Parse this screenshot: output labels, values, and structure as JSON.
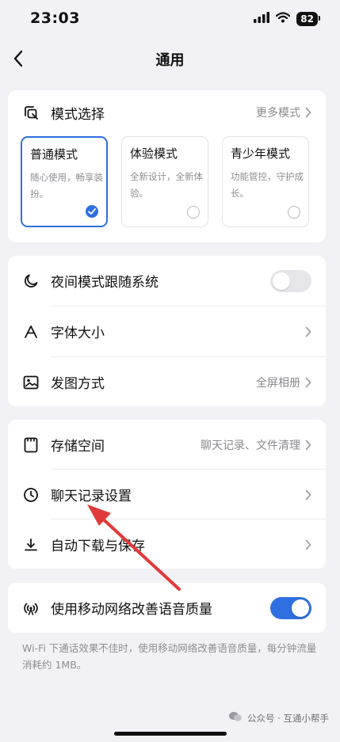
{
  "status_bar": {
    "time": "23:03",
    "battery": "82"
  },
  "nav": {
    "title": "通用"
  },
  "mode_section": {
    "label": "模式选择",
    "more": "更多模式",
    "modes": [
      {
        "title": "普通模式",
        "desc": "随心使用，畅享装扮。",
        "selected": true
      },
      {
        "title": "体验模式",
        "desc": "全新设计，全新体验。",
        "selected": false
      },
      {
        "title": "青少年模式",
        "desc": "功能管控，守护成长。",
        "selected": false
      }
    ]
  },
  "display_section": {
    "night_mode": {
      "label": "夜间模式跟随系统",
      "enabled": false
    },
    "font_size": {
      "label": "字体大小"
    },
    "image_send": {
      "label": "发图方式",
      "value": "全屏相册"
    }
  },
  "storage_section": {
    "storage": {
      "label": "存储空间",
      "value": "聊天记录、文件清理"
    },
    "chat_history": {
      "label": "聊天记录设置"
    },
    "auto_download": {
      "label": "自动下载与保存"
    }
  },
  "network_section": {
    "label": "使用移动网络改善语音质量",
    "enabled": true,
    "note": "Wi-Fi 下通话效果不佳时，使用移动网络改善语音质量，每分钟流量消耗约 1MB。"
  },
  "watermark": "公众号 · 互通小帮手",
  "colors": {
    "accent": "#2f6fe0",
    "arrow": "#e03a3a",
    "background": "#f2f2f6"
  }
}
